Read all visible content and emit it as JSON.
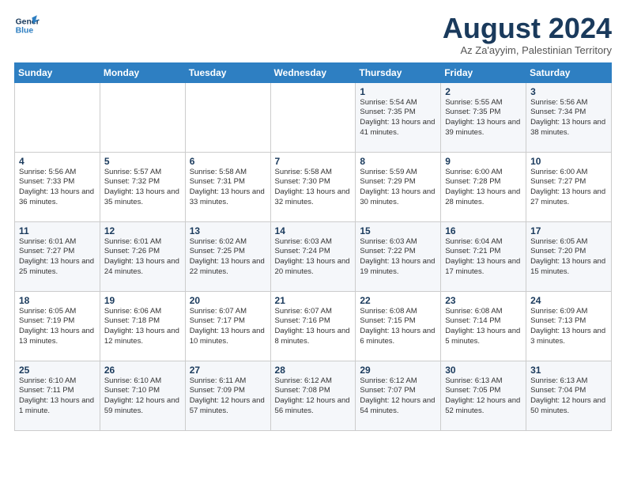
{
  "header": {
    "logo_line1": "General",
    "logo_line2": "Blue",
    "month": "August 2024",
    "location": "Az Za'ayyim, Palestinian Territory"
  },
  "days": [
    "Sunday",
    "Monday",
    "Tuesday",
    "Wednesday",
    "Thursday",
    "Friday",
    "Saturday"
  ],
  "weeks": [
    [
      {
        "date": "",
        "sunrise": "",
        "sunset": "",
        "daylight": ""
      },
      {
        "date": "",
        "sunrise": "",
        "sunset": "",
        "daylight": ""
      },
      {
        "date": "",
        "sunrise": "",
        "sunset": "",
        "daylight": ""
      },
      {
        "date": "",
        "sunrise": "",
        "sunset": "",
        "daylight": ""
      },
      {
        "date": "1",
        "sunrise": "Sunrise: 5:54 AM",
        "sunset": "Sunset: 7:35 PM",
        "daylight": "Daylight: 13 hours and 41 minutes."
      },
      {
        "date": "2",
        "sunrise": "Sunrise: 5:55 AM",
        "sunset": "Sunset: 7:35 PM",
        "daylight": "Daylight: 13 hours and 39 minutes."
      },
      {
        "date": "3",
        "sunrise": "Sunrise: 5:56 AM",
        "sunset": "Sunset: 7:34 PM",
        "daylight": "Daylight: 13 hours and 38 minutes."
      }
    ],
    [
      {
        "date": "4",
        "sunrise": "Sunrise: 5:56 AM",
        "sunset": "Sunset: 7:33 PM",
        "daylight": "Daylight: 13 hours and 36 minutes."
      },
      {
        "date": "5",
        "sunrise": "Sunrise: 5:57 AM",
        "sunset": "Sunset: 7:32 PM",
        "daylight": "Daylight: 13 hours and 35 minutes."
      },
      {
        "date": "6",
        "sunrise": "Sunrise: 5:58 AM",
        "sunset": "Sunset: 7:31 PM",
        "daylight": "Daylight: 13 hours and 33 minutes."
      },
      {
        "date": "7",
        "sunrise": "Sunrise: 5:58 AM",
        "sunset": "Sunset: 7:30 PM",
        "daylight": "Daylight: 13 hours and 32 minutes."
      },
      {
        "date": "8",
        "sunrise": "Sunrise: 5:59 AM",
        "sunset": "Sunset: 7:29 PM",
        "daylight": "Daylight: 13 hours and 30 minutes."
      },
      {
        "date": "9",
        "sunrise": "Sunrise: 6:00 AM",
        "sunset": "Sunset: 7:28 PM",
        "daylight": "Daylight: 13 hours and 28 minutes."
      },
      {
        "date": "10",
        "sunrise": "Sunrise: 6:00 AM",
        "sunset": "Sunset: 7:27 PM",
        "daylight": "Daylight: 13 hours and 27 minutes."
      }
    ],
    [
      {
        "date": "11",
        "sunrise": "Sunrise: 6:01 AM",
        "sunset": "Sunset: 7:27 PM",
        "daylight": "Daylight: 13 hours and 25 minutes."
      },
      {
        "date": "12",
        "sunrise": "Sunrise: 6:01 AM",
        "sunset": "Sunset: 7:26 PM",
        "daylight": "Daylight: 13 hours and 24 minutes."
      },
      {
        "date": "13",
        "sunrise": "Sunrise: 6:02 AM",
        "sunset": "Sunset: 7:25 PM",
        "daylight": "Daylight: 13 hours and 22 minutes."
      },
      {
        "date": "14",
        "sunrise": "Sunrise: 6:03 AM",
        "sunset": "Sunset: 7:24 PM",
        "daylight": "Daylight: 13 hours and 20 minutes."
      },
      {
        "date": "15",
        "sunrise": "Sunrise: 6:03 AM",
        "sunset": "Sunset: 7:22 PM",
        "daylight": "Daylight: 13 hours and 19 minutes."
      },
      {
        "date": "16",
        "sunrise": "Sunrise: 6:04 AM",
        "sunset": "Sunset: 7:21 PM",
        "daylight": "Daylight: 13 hours and 17 minutes."
      },
      {
        "date": "17",
        "sunrise": "Sunrise: 6:05 AM",
        "sunset": "Sunset: 7:20 PM",
        "daylight": "Daylight: 13 hours and 15 minutes."
      }
    ],
    [
      {
        "date": "18",
        "sunrise": "Sunrise: 6:05 AM",
        "sunset": "Sunset: 7:19 PM",
        "daylight": "Daylight: 13 hours and 13 minutes."
      },
      {
        "date": "19",
        "sunrise": "Sunrise: 6:06 AM",
        "sunset": "Sunset: 7:18 PM",
        "daylight": "Daylight: 13 hours and 12 minutes."
      },
      {
        "date": "20",
        "sunrise": "Sunrise: 6:07 AM",
        "sunset": "Sunset: 7:17 PM",
        "daylight": "Daylight: 13 hours and 10 minutes."
      },
      {
        "date": "21",
        "sunrise": "Sunrise: 6:07 AM",
        "sunset": "Sunset: 7:16 PM",
        "daylight": "Daylight: 13 hours and 8 minutes."
      },
      {
        "date": "22",
        "sunrise": "Sunrise: 6:08 AM",
        "sunset": "Sunset: 7:15 PM",
        "daylight": "Daylight: 13 hours and 6 minutes."
      },
      {
        "date": "23",
        "sunrise": "Sunrise: 6:08 AM",
        "sunset": "Sunset: 7:14 PM",
        "daylight": "Daylight: 13 hours and 5 minutes."
      },
      {
        "date": "24",
        "sunrise": "Sunrise: 6:09 AM",
        "sunset": "Sunset: 7:13 PM",
        "daylight": "Daylight: 13 hours and 3 minutes."
      }
    ],
    [
      {
        "date": "25",
        "sunrise": "Sunrise: 6:10 AM",
        "sunset": "Sunset: 7:11 PM",
        "daylight": "Daylight: 13 hours and 1 minute."
      },
      {
        "date": "26",
        "sunrise": "Sunrise: 6:10 AM",
        "sunset": "Sunset: 7:10 PM",
        "daylight": "Daylight: 12 hours and 59 minutes."
      },
      {
        "date": "27",
        "sunrise": "Sunrise: 6:11 AM",
        "sunset": "Sunset: 7:09 PM",
        "daylight": "Daylight: 12 hours and 57 minutes."
      },
      {
        "date": "28",
        "sunrise": "Sunrise: 6:12 AM",
        "sunset": "Sunset: 7:08 PM",
        "daylight": "Daylight: 12 hours and 56 minutes."
      },
      {
        "date": "29",
        "sunrise": "Sunrise: 6:12 AM",
        "sunset": "Sunset: 7:07 PM",
        "daylight": "Daylight: 12 hours and 54 minutes."
      },
      {
        "date": "30",
        "sunrise": "Sunrise: 6:13 AM",
        "sunset": "Sunset: 7:05 PM",
        "daylight": "Daylight: 12 hours and 52 minutes."
      },
      {
        "date": "31",
        "sunrise": "Sunrise: 6:13 AM",
        "sunset": "Sunset: 7:04 PM",
        "daylight": "Daylight: 12 hours and 50 minutes."
      }
    ]
  ]
}
